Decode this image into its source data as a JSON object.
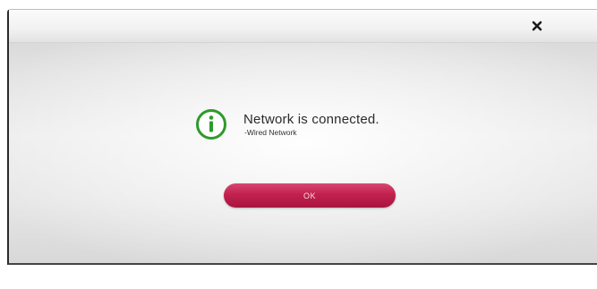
{
  "dialog": {
    "close_icon": "close-icon",
    "message": {
      "icon": "info-icon",
      "title": "Network is connected.",
      "subtitle": "-Wired Network"
    },
    "ok_label": "OK",
    "accent_color": "#c2214f",
    "icon_color": "#2f9a2a"
  }
}
